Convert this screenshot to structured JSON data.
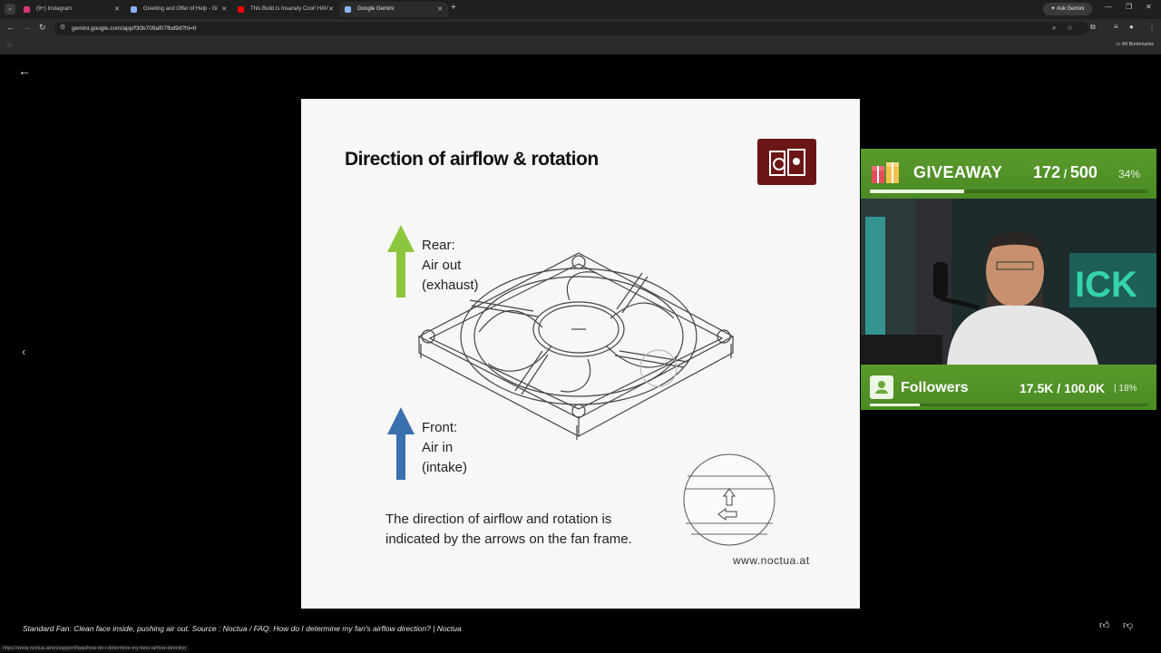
{
  "browser": {
    "tabs": [
      {
        "label": "(9+) Instagram",
        "favicon_color": "#d6367a"
      },
      {
        "label": "Greeting and Offer of Help - Gi",
        "favicon_color": "#8ab4f8"
      },
      {
        "label": "This Build is Insanely Cool! HAV",
        "favicon_color": "#ff0000"
      },
      {
        "label": "Google Gemini",
        "favicon_color": "#8ab4f8"
      }
    ],
    "ask_gemini": "Ask Gemini",
    "url": "gemini.google.com/app/f30b709af07fbd9d?hl=fr",
    "all_bookmarks": "All Bookmarks"
  },
  "slide": {
    "title": "Direction of airflow & rotation",
    "rear": {
      "line1": "Rear:",
      "line2": "Air out",
      "line3": "(exhaust)",
      "arrow_color": "#8cc63f"
    },
    "front": {
      "line1": "Front:",
      "line2": "Air in",
      "line3": "(intake)",
      "arrow_color": "#3a6fb0"
    },
    "caption_line1": "The direction of airflow and rotation is",
    "caption_line2": "indicated by the arrows on the fan frame.",
    "website": "www.noctua.at"
  },
  "source_text": "Standard Fan: Clean face inside, pushing air out. Source  : Noctua / FAQ: How do I determine my fan's airflow direction? | Noctua",
  "status_url": "https://www.noctua.at/en/support/faqs/how-do-i-determine-my-fans-airflow-direction",
  "giveaway": {
    "title": "GIVEAWAY",
    "current": "172",
    "goal": "500",
    "percent_label": "34%",
    "progress": 0.34
  },
  "followers": {
    "title": "Followers",
    "count": "17.5K / 100.0K",
    "percent_label": "| 18%",
    "progress": 0.18
  }
}
